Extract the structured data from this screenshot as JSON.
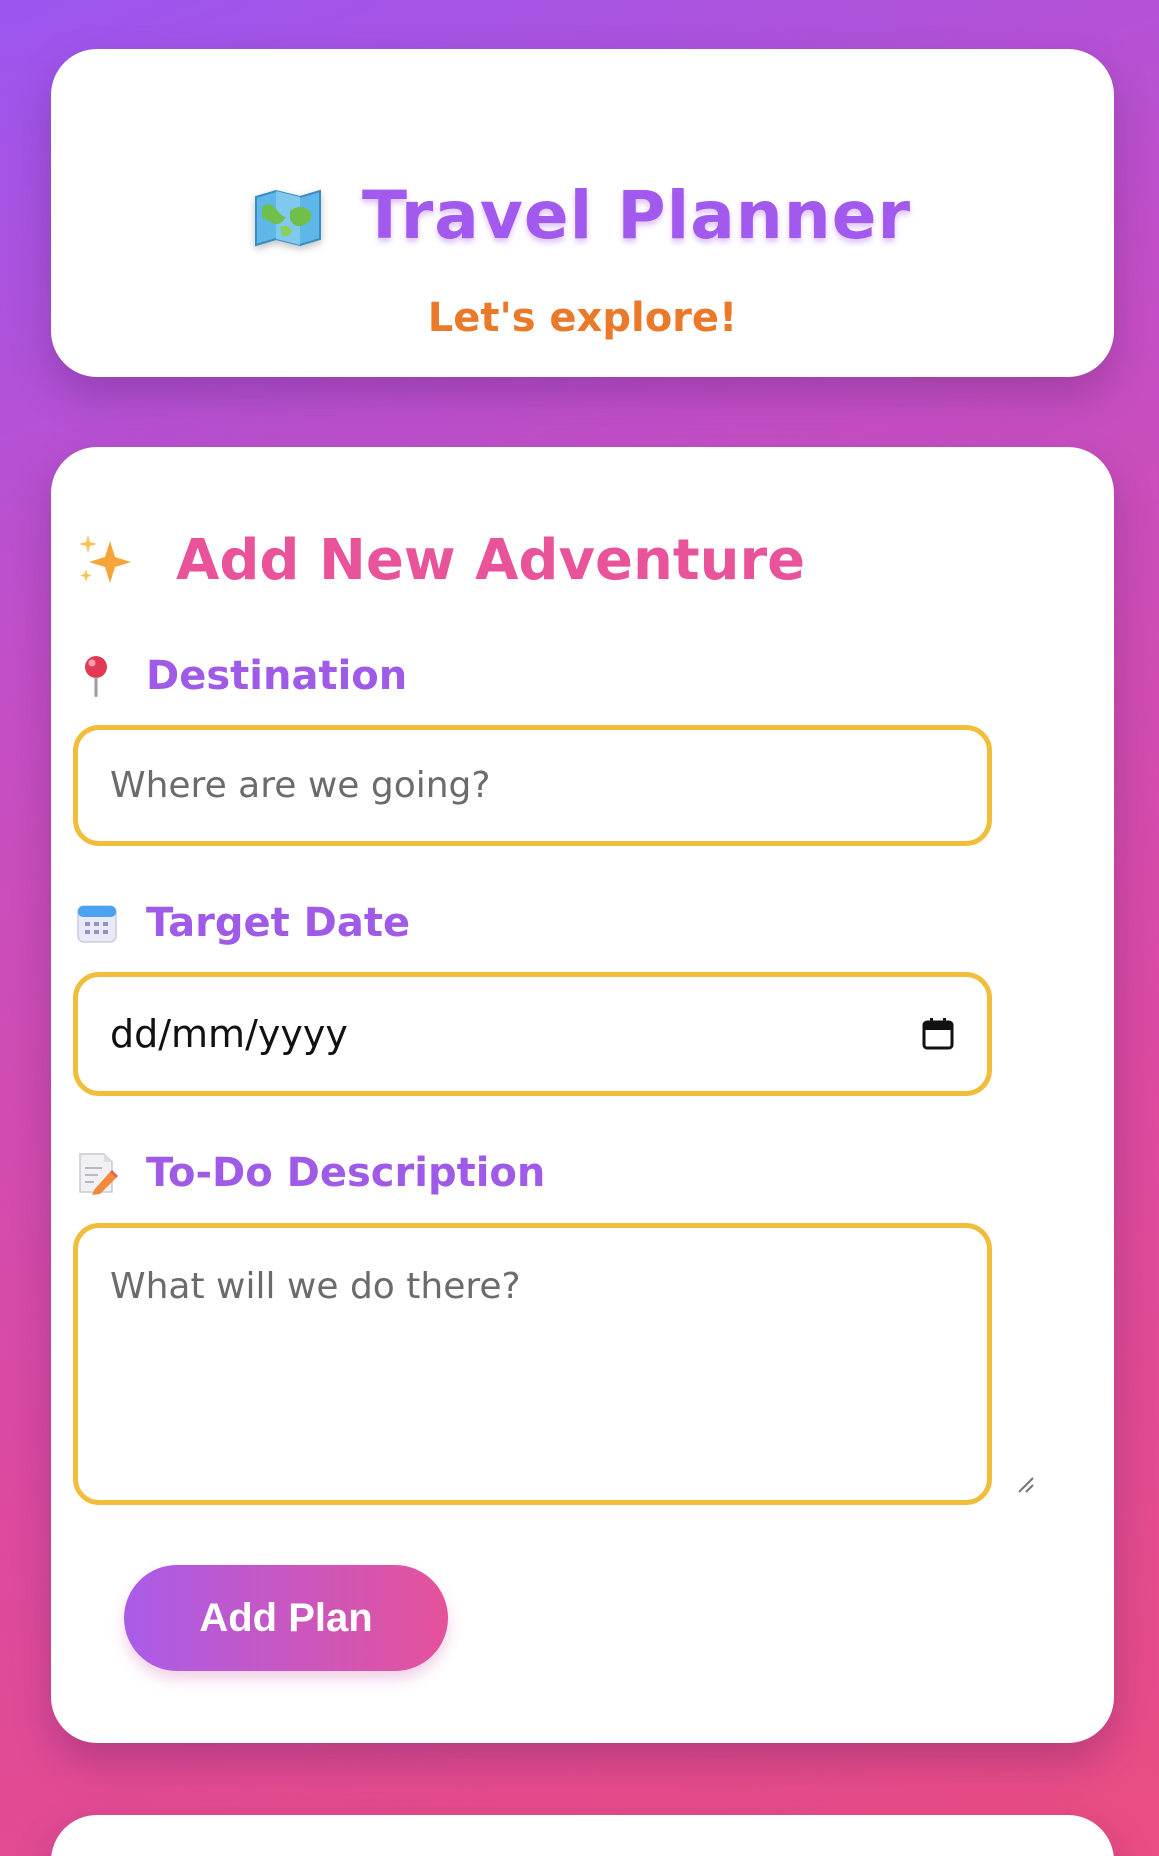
{
  "header": {
    "title": "Travel Planner",
    "subtitle": "Let's explore!",
    "icon": "world-map-icon"
  },
  "form": {
    "section_title": "Add New Adventure",
    "section_icon": "sparkles-icon",
    "destination": {
      "label": "Destination",
      "icon": "pushpin-icon",
      "value": "",
      "placeholder": "Where are we going?"
    },
    "date": {
      "label": "Target Date",
      "icon": "calendar-icon",
      "value": "dd/mm/yyyy",
      "picker_icon": "calendar-picker-icon"
    },
    "description": {
      "label": "To-Do Description",
      "icon": "memo-icon",
      "value": "",
      "placeholder": "What will we do there?"
    },
    "submit_label": "Add Plan"
  },
  "colors": {
    "title": "#a259ee",
    "subtitle": "#ea7a2a",
    "section_title": "#e8539a",
    "label": "#a05ae8",
    "input_border": "#f0be3a",
    "button_gradient_start": "#a95ce9",
    "button_gradient_end": "#e6529a"
  }
}
